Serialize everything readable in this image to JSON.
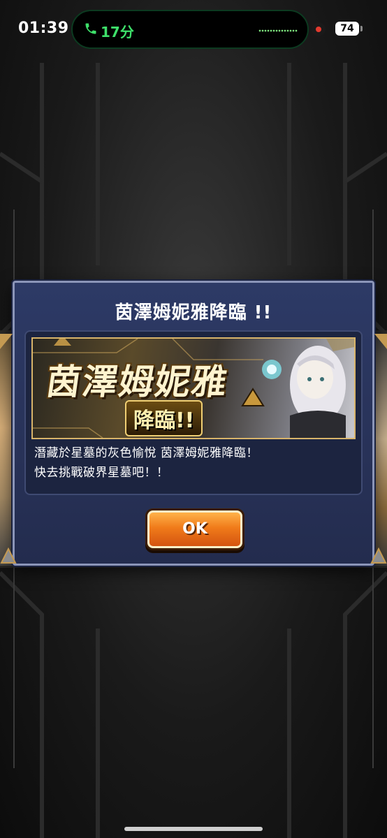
{
  "status_bar": {
    "time": "01:39",
    "call_duration": "17分",
    "battery": "74"
  },
  "dialog": {
    "title": "茵澤姆妮雅降臨 !!",
    "banner_title": "茵澤姆妮雅",
    "banner_subtitle": "降臨!!",
    "message_lines": [
      "潛藏於星墓的灰色愉悅 茵澤姆妮雅降臨！",
      "快去挑戰破界星墓吧！！"
    ],
    "ok_label": "OK"
  },
  "colors": {
    "dialog_bg": "#2d3a66",
    "ok_button": "#f07b1a",
    "call_green": "#3ee06a"
  }
}
